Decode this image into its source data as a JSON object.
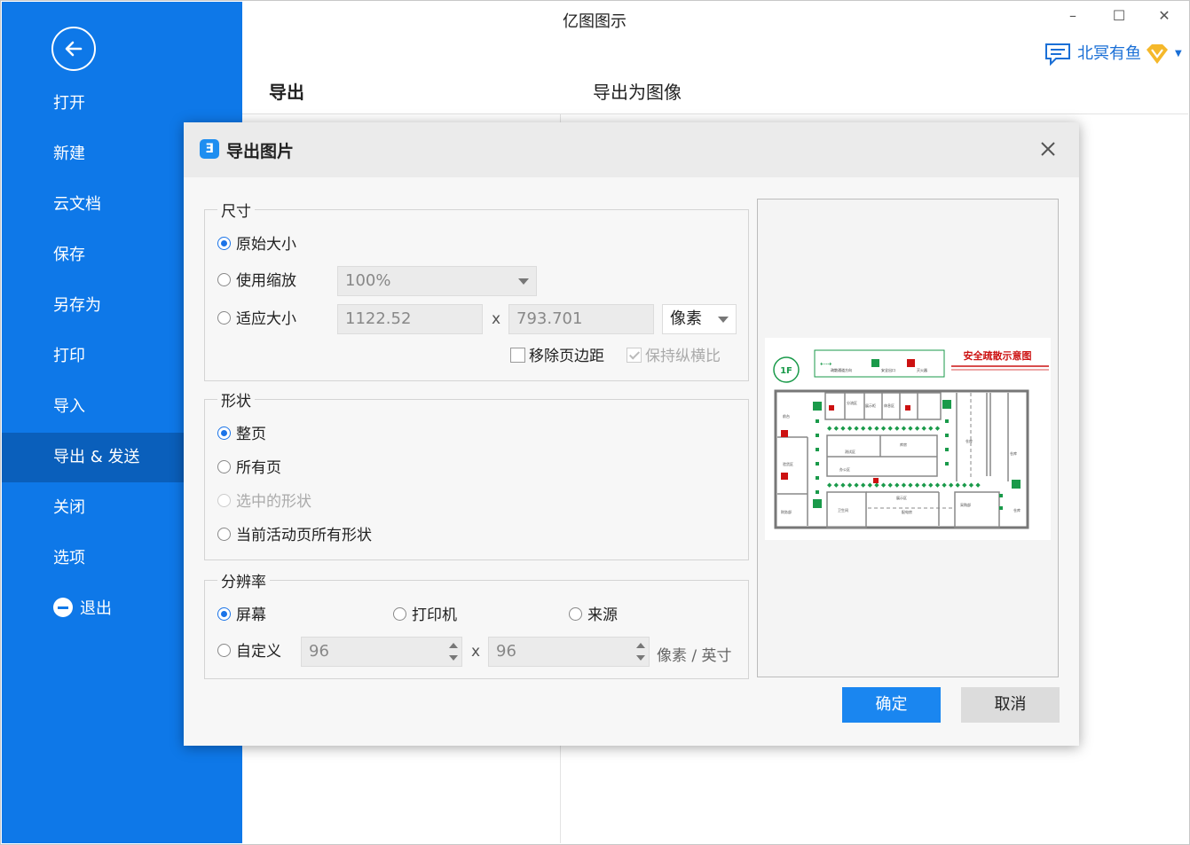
{
  "app": {
    "title": "亿图图示",
    "minimize": "–",
    "maximize": "☐",
    "close": "✕",
    "user_name": "北冥有鱼"
  },
  "sidebar": {
    "items": [
      {
        "label": "打开"
      },
      {
        "label": "新建"
      },
      {
        "label": "云文档"
      },
      {
        "label": "保存"
      },
      {
        "label": "另存为"
      },
      {
        "label": "打印"
      },
      {
        "label": "导入"
      },
      {
        "label": "导出 & 发送",
        "active": true
      },
      {
        "label": "关闭"
      },
      {
        "label": "选项"
      },
      {
        "label": "退出"
      }
    ]
  },
  "main": {
    "section_title": "导出",
    "sub_title": "导出为图像"
  },
  "dialog": {
    "title": "导出图片",
    "size": {
      "legend": "尺寸",
      "original": "原始大小",
      "use_scale": "使用缩放",
      "scale_value": "100%",
      "fit_size": "适应大小",
      "width": "1122.52",
      "height": "793.701",
      "times": "x",
      "unit": "像素",
      "remove_margin": "移除页边距",
      "keep_ratio": "保持纵横比"
    },
    "shape": {
      "legend": "形状",
      "whole_page": "整页",
      "all_pages": "所有页",
      "selected_shapes": "选中的形状",
      "active_page_shapes": "当前活动页所有形状"
    },
    "resolution": {
      "legend": "分辨率",
      "screen": "屏幕",
      "printer": "打印机",
      "source": "来源",
      "custom": "自定义",
      "dpi_x": "96",
      "dpi_y": "96",
      "times": "x",
      "unit": "像素 / 英寸"
    },
    "preview": {
      "floor_label": "1F",
      "title": "安全疏散示意图",
      "legend_texts": [
        "疏散通道方向",
        "安全出口",
        "灭火器"
      ],
      "room_labels": [
        "分流区",
        "展示柜",
        "休息区",
        "测试区",
        "库房",
        "仓库",
        "验货区",
        "办公区",
        "仓库",
        "卫生间",
        "前台",
        "展示区",
        "配电房",
        "仓库",
        "采购部",
        "财务部"
      ]
    },
    "ok": "确定",
    "cancel": "取消"
  },
  "colors": {
    "sidebar_bg": "#0e78e8",
    "sidebar_active": "#0a5fbb",
    "accent": "#1a86f0",
    "evac_green": "#1a9a4a",
    "evac_red": "#cc1111"
  }
}
